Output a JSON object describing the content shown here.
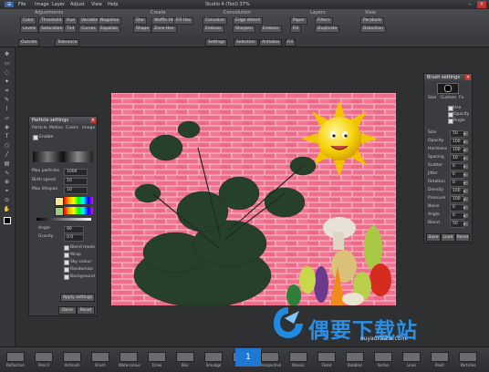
{
  "app": {
    "title": "Studio 4 (Tool) 37%"
  },
  "menu": [
    "File",
    "Image",
    "Layer",
    "Adjust",
    "View",
    "Help"
  ],
  "ribbon": {
    "groups": [
      {
        "title": "Adjustments",
        "buttons": [
          "Color",
          "Threshold",
          "Hue",
          "Variable",
          "Negative",
          "Levels",
          "Saturation",
          "Tint",
          "Curves",
          "Equalize"
        ]
      },
      {
        "title": "Create",
        "buttons": [
          "Star",
          "Shape",
          "Waffle Hex",
          "Zone Hex",
          "Fill Hex"
        ]
      },
      {
        "title": "Convolution",
        "buttons": [
          "Convolve",
          "Edge detect",
          "Emboss",
          "Sharpen",
          "Emboss"
        ]
      },
      {
        "title": "Layers",
        "buttons": [
          "Paper",
          "Filters",
          "Fill",
          "Duplicate"
        ]
      },
      {
        "title": "View",
        "buttons": [
          "Parabolic",
          "Distortion"
        ]
      }
    ]
  },
  "optbar": {
    "buttons": [
      "Outside",
      "Tolerance",
      "Settings",
      "Selection",
      "Antialias",
      "Fill"
    ]
  },
  "particle_panel": {
    "title": "Particle settings",
    "tabs": [
      "Particle",
      "Motion",
      "Colors",
      "Image"
    ],
    "enable_label": "Enable",
    "fields": [
      {
        "label": "Max particles",
        "value": "1000"
      },
      {
        "label": "Birth speed",
        "value": "10"
      },
      {
        "label": "Max lifespan",
        "value": "10"
      },
      {
        "label": "Angle",
        "value": "90"
      },
      {
        "label": "Gravity",
        "value": "0.0"
      }
    ],
    "checks": [
      "Blend mode",
      "Wrap",
      "Sky colour",
      "Randomize",
      "Background"
    ],
    "buttons": {
      "apply": "Apply settings",
      "done": "Done",
      "reset": "Reset"
    }
  },
  "brush_panel": {
    "title": "Brush settings",
    "tabs": [
      "Size",
      "Custom",
      "Fx"
    ],
    "checks": [
      "Use",
      "Opacity",
      "Angle"
    ],
    "labels": [
      "Size",
      "Opacity",
      "Hardness",
      "Spacing",
      "Scatter",
      "Jitter",
      "Rotation",
      "Density",
      "Pressure",
      "Noise",
      "Angle",
      "Blend"
    ],
    "values": [
      "50",
      "100",
      "100",
      "10",
      "0",
      "0",
      "0",
      "100",
      "100",
      "0",
      "0",
      "50"
    ],
    "buttons": [
      "Save",
      "Load",
      "Reset"
    ]
  },
  "bottom_tools": [
    "Reflection",
    "Pencil",
    "Airbrush",
    "Brush",
    "Watercolour",
    "Draw",
    "Blur",
    "Smudge",
    "Clone",
    "Perspective",
    "Mosaic",
    "Flood",
    "Bubbles",
    "Vortex",
    "Lines",
    "Paint",
    "Particles"
  ],
  "watermark": {
    "main": "偶要下载站",
    "url": "ouyaoxiazai.com"
  },
  "badge": {
    "number": "1"
  },
  "colors": {
    "accent": "#3c63a8",
    "bg": "#2f3032",
    "brick": "#f06a8a",
    "mortar": "#f8cbd4"
  }
}
